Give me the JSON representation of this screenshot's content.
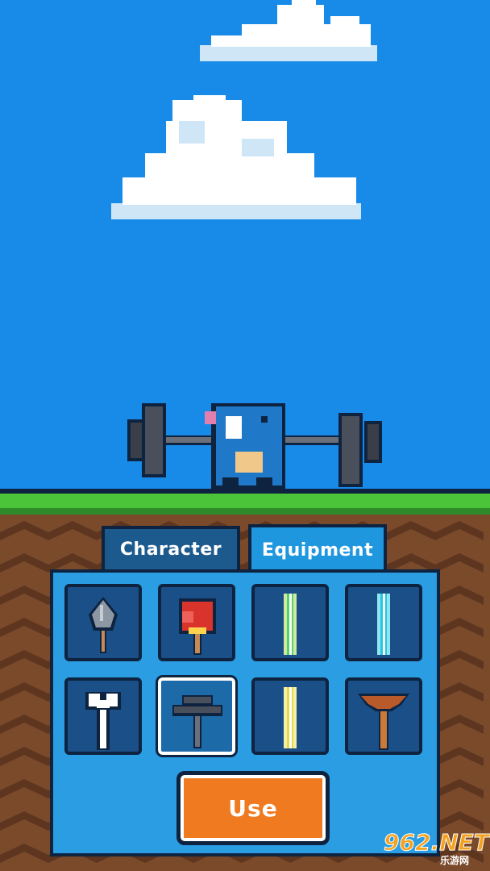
{
  "tabs": [
    {
      "label": "Character",
      "active": false
    },
    {
      "label": "Equipment",
      "active": true
    }
  ],
  "equipment_slots": [
    {
      "icon": "shovel-icon",
      "selected": false
    },
    {
      "icon": "boxing-glove-icon",
      "selected": false
    },
    {
      "icon": "green-lightsaber-icon",
      "selected": false
    },
    {
      "icon": "cyan-lightsaber-icon",
      "selected": false
    },
    {
      "icon": "bone-icon",
      "selected": false
    },
    {
      "icon": "dumbbell-plate-icon",
      "selected": true
    },
    {
      "icon": "yellow-lightsaber-icon",
      "selected": false
    },
    {
      "icon": "plunger-icon",
      "selected": false
    }
  ],
  "use_button": {
    "label": "Use"
  },
  "watermark": {
    "main": "962.NET",
    "sub": "乐游网"
  },
  "colors": {
    "sky": "#178be7",
    "grass": "#4cc43a",
    "dirt": "#7a4a2b",
    "panel": "#2b9de2",
    "slot": "#1b4f87",
    "button": "#f07a1f",
    "outline": "#0d2340"
  }
}
